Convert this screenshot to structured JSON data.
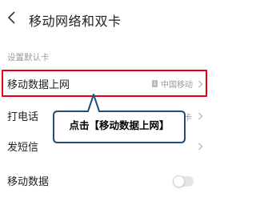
{
  "header": {
    "back_icon": "chevron-left-icon",
    "title": "移动网络和双卡"
  },
  "section_label": "设置默认卡",
  "rows": {
    "mobile_data_internet": {
      "label": "移动数据上网",
      "sim_badge": "1",
      "value": "中国移动",
      "icon": "chevron-right-icon"
    },
    "call": {
      "label": "打电话",
      "tail": "卡",
      "icon": "chevron-right-icon"
    },
    "sms": {
      "label": "发短信",
      "icon": "chevron-right-icon"
    },
    "mobile_data": {
      "label": "移动数据",
      "toggle_on": false
    }
  },
  "callout": {
    "text": "点击【移动数据上网】"
  },
  "colors": {
    "highlight": "#e60012",
    "callout_border": "#1f4e79",
    "callout_fill": "#ffffff"
  }
}
